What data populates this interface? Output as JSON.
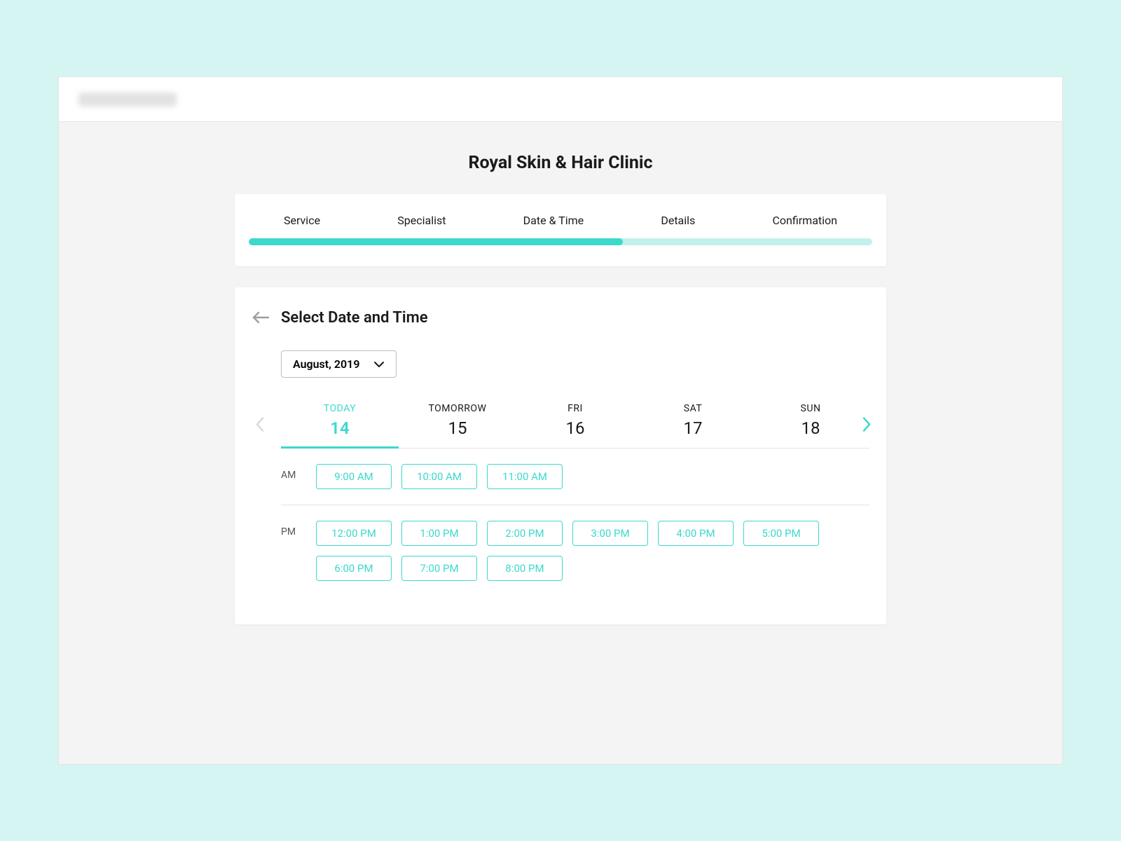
{
  "page": {
    "title": "Royal Skin & Hair Clinic"
  },
  "progress": {
    "steps": [
      "Service",
      "Specialist",
      "Date & Time",
      "Details",
      "Confirmation"
    ],
    "fill_percent": 60
  },
  "datetime": {
    "title": "Select Date and Time",
    "month_label": "August, 2019",
    "dates": [
      {
        "day": "TODAY",
        "num": "14",
        "active": true
      },
      {
        "day": "TOMORROW",
        "num": "15",
        "active": false
      },
      {
        "day": "FRI",
        "num": "16",
        "active": false
      },
      {
        "day": "SAT",
        "num": "17",
        "active": false
      },
      {
        "day": "SUN",
        "num": "18",
        "active": false
      }
    ],
    "am_label": "AM",
    "pm_label": "PM",
    "am_slots": [
      "9:00 AM",
      "10:00 AM",
      "11:00 AM"
    ],
    "pm_slots": [
      "12:00 PM",
      "1:00 PM",
      "2:00 PM",
      "3:00 PM",
      "4:00 PM",
      "5:00 PM",
      "6:00 PM",
      "7:00 PM",
      "8:00 PM"
    ]
  }
}
